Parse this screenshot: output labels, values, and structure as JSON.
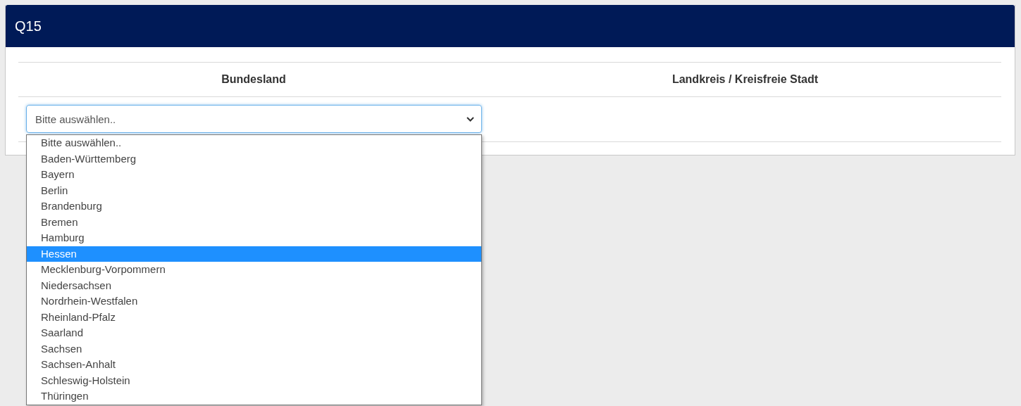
{
  "panel": {
    "title": "Q15"
  },
  "table": {
    "columns": [
      "Bundesland",
      "Landkreis / Kreisfreie Stadt"
    ]
  },
  "select": {
    "value": "Bitte auswählen..",
    "expanded": true
  },
  "options": [
    {
      "label": "Bitte auswählen..",
      "selected": false
    },
    {
      "label": "Baden-Württemberg",
      "selected": false
    },
    {
      "label": "Bayern",
      "selected": false
    },
    {
      "label": "Berlin",
      "selected": false
    },
    {
      "label": "Brandenburg",
      "selected": false
    },
    {
      "label": "Bremen",
      "selected": false
    },
    {
      "label": "Hamburg",
      "selected": false
    },
    {
      "label": "Hessen",
      "selected": true
    },
    {
      "label": "Mecklenburg-Vorpommern",
      "selected": false
    },
    {
      "label": "Niedersachsen",
      "selected": false
    },
    {
      "label": "Nordrhein-Westfalen",
      "selected": false
    },
    {
      "label": "Rheinland-Pfalz",
      "selected": false
    },
    {
      "label": "Saarland",
      "selected": false
    },
    {
      "label": "Sachsen",
      "selected": false
    },
    {
      "label": "Sachsen-Anhalt",
      "selected": false
    },
    {
      "label": "Schleswig-Holstein",
      "selected": false
    },
    {
      "label": "Thüringen",
      "selected": false
    }
  ]
}
